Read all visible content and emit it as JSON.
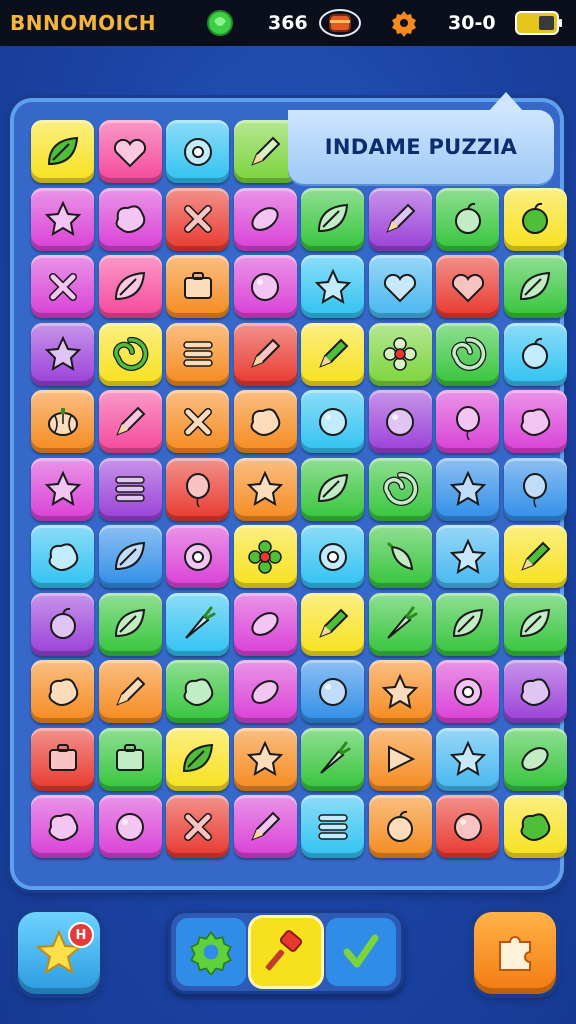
{
  "status_bar": {
    "title": "BNNOMOICH",
    "gem_icon": "green-gem-icon",
    "score": "366",
    "chest_icon": "treasure-chest-icon",
    "gear_icon": "gear-icon",
    "moves": "30-0",
    "battery_icon": "battery-icon"
  },
  "banner": {
    "text": "INDAME PUZZIA"
  },
  "colors": {
    "yellow": "#f7e11c",
    "pink": "#f5479b",
    "cyan": "#2fc2f2",
    "lime": "#7ad43a",
    "magenta": "#d93fd6",
    "green": "#35c43a",
    "red": "#e8382e",
    "purple": "#9a3fd8",
    "orange": "#f58a1e",
    "blue": "#2f8de8",
    "sky": "#46b7f0"
  },
  "board": {
    "rows": [
      [
        {
          "c": "yellow",
          "i": "leaf"
        },
        {
          "c": "pink",
          "i": "heart"
        },
        {
          "c": "cyan",
          "i": "donut"
        },
        {
          "c": "lime",
          "i": "pencil"
        },
        {
          "c": "",
          "i": ""
        },
        {
          "c": "",
          "i": ""
        },
        {
          "c": "",
          "i": ""
        },
        {
          "c": "",
          "i": ""
        }
      ],
      [
        {
          "c": "magenta",
          "i": "star"
        },
        {
          "c": "magenta",
          "i": "blob"
        },
        {
          "c": "red",
          "i": "cross"
        },
        {
          "c": "magenta",
          "i": "bean"
        },
        {
          "c": "green",
          "i": "leaf"
        },
        {
          "c": "purple",
          "i": "pencil"
        },
        {
          "c": "green",
          "i": "apple"
        },
        {
          "c": "yellow",
          "i": "apple"
        }
      ],
      [
        {
          "c": "magenta",
          "i": "cross"
        },
        {
          "c": "pink",
          "i": "leaf"
        },
        {
          "c": "orange",
          "i": "box"
        },
        {
          "c": "magenta",
          "i": "ball"
        },
        {
          "c": "cyan",
          "i": "star"
        },
        {
          "c": "sky",
          "i": "heart"
        },
        {
          "c": "red",
          "i": "heart"
        },
        {
          "c": "green",
          "i": "leaf"
        }
      ],
      [
        {
          "c": "purple",
          "i": "star"
        },
        {
          "c": "yellow",
          "i": "swirl"
        },
        {
          "c": "orange",
          "i": "stripes"
        },
        {
          "c": "red",
          "i": "pencil"
        },
        {
          "c": "yellow",
          "i": "pencil"
        },
        {
          "c": "lime",
          "i": "flower"
        },
        {
          "c": "green",
          "i": "swirl"
        },
        {
          "c": "cyan",
          "i": "apple"
        }
      ],
      [
        {
          "c": "orange",
          "i": "pumpkin"
        },
        {
          "c": "pink",
          "i": "pencil"
        },
        {
          "c": "orange",
          "i": "cross"
        },
        {
          "c": "orange",
          "i": "blob"
        },
        {
          "c": "cyan",
          "i": "ball"
        },
        {
          "c": "purple",
          "i": "ball"
        },
        {
          "c": "magenta",
          "i": "balloon"
        },
        {
          "c": "magenta",
          "i": "blob"
        }
      ],
      [
        {
          "c": "magenta",
          "i": "star"
        },
        {
          "c": "purple",
          "i": "stripes"
        },
        {
          "c": "red",
          "i": "balloon"
        },
        {
          "c": "orange",
          "i": "star"
        },
        {
          "c": "green",
          "i": "leaf"
        },
        {
          "c": "green",
          "i": "swirl"
        },
        {
          "c": "blue",
          "i": "star"
        },
        {
          "c": "blue",
          "i": "balloon"
        }
      ],
      [
        {
          "c": "cyan",
          "i": "blob"
        },
        {
          "c": "blue",
          "i": "leaf"
        },
        {
          "c": "magenta",
          "i": "donut"
        },
        {
          "c": "yellow",
          "i": "flower"
        },
        {
          "c": "cyan",
          "i": "donut"
        },
        {
          "c": "green",
          "i": "pepper"
        },
        {
          "c": "sky",
          "i": "star"
        },
        {
          "c": "yellow",
          "i": "pencil"
        }
      ],
      [
        {
          "c": "purple",
          "i": "apple"
        },
        {
          "c": "green",
          "i": "leaf"
        },
        {
          "c": "cyan",
          "i": "carrot"
        },
        {
          "c": "magenta",
          "i": "bean"
        },
        {
          "c": "yellow",
          "i": "pencil"
        },
        {
          "c": "green",
          "i": "carrot"
        },
        {
          "c": "green",
          "i": "leaf"
        },
        {
          "c": "green",
          "i": "leaf"
        }
      ],
      [
        {
          "c": "orange",
          "i": "blob"
        },
        {
          "c": "orange",
          "i": "pencil"
        },
        {
          "c": "green",
          "i": "blob"
        },
        {
          "c": "magenta",
          "i": "bean"
        },
        {
          "c": "blue",
          "i": "ball"
        },
        {
          "c": "orange",
          "i": "star"
        },
        {
          "c": "magenta",
          "i": "donut"
        },
        {
          "c": "purple",
          "i": "blob"
        }
      ],
      [
        {
          "c": "red",
          "i": "box"
        },
        {
          "c": "green",
          "i": "box"
        },
        {
          "c": "yellow",
          "i": "leaf"
        },
        {
          "c": "orange",
          "i": "star"
        },
        {
          "c": "green",
          "i": "carrot"
        },
        {
          "c": "orange",
          "i": "triangle"
        },
        {
          "c": "sky",
          "i": "star"
        },
        {
          "c": "green",
          "i": "bean"
        }
      ],
      [
        {
          "c": "magenta",
          "i": "blob"
        },
        {
          "c": "magenta",
          "i": "ball"
        },
        {
          "c": "red",
          "i": "cross"
        },
        {
          "c": "magenta",
          "i": "pencil"
        },
        {
          "c": "cyan",
          "i": "stripes"
        },
        {
          "c": "orange",
          "i": "apple"
        },
        {
          "c": "red",
          "i": "ball"
        },
        {
          "c": "yellow",
          "i": "blob"
        }
      ]
    ]
  },
  "bottom_bar": {
    "star_button_icon": "star-icon",
    "star_button_badge": "H",
    "tray_items": [
      {
        "icon": "gear-icon",
        "color": "#2f8de8"
      },
      {
        "icon": "hammer-icon",
        "color": "#f7e11c"
      },
      {
        "icon": "checkmark-icon",
        "color": "#2f8de8"
      }
    ],
    "puzzle_button_icon": "puzzle-piece-icon"
  }
}
